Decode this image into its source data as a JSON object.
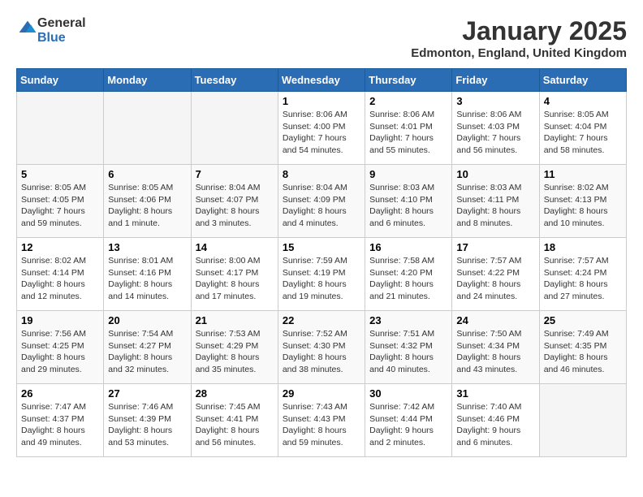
{
  "header": {
    "logo_general": "General",
    "logo_blue": "Blue",
    "title": "January 2025",
    "subtitle": "Edmonton, England, United Kingdom"
  },
  "days_of_week": [
    "Sunday",
    "Monday",
    "Tuesday",
    "Wednesday",
    "Thursday",
    "Friday",
    "Saturday"
  ],
  "weeks": [
    [
      {
        "day": "",
        "info": ""
      },
      {
        "day": "",
        "info": ""
      },
      {
        "day": "",
        "info": ""
      },
      {
        "day": "1",
        "info": "Sunrise: 8:06 AM\nSunset: 4:00 PM\nDaylight: 7 hours\nand 54 minutes."
      },
      {
        "day": "2",
        "info": "Sunrise: 8:06 AM\nSunset: 4:01 PM\nDaylight: 7 hours\nand 55 minutes."
      },
      {
        "day": "3",
        "info": "Sunrise: 8:06 AM\nSunset: 4:03 PM\nDaylight: 7 hours\nand 56 minutes."
      },
      {
        "day": "4",
        "info": "Sunrise: 8:05 AM\nSunset: 4:04 PM\nDaylight: 7 hours\nand 58 minutes."
      }
    ],
    [
      {
        "day": "5",
        "info": "Sunrise: 8:05 AM\nSunset: 4:05 PM\nDaylight: 7 hours\nand 59 minutes."
      },
      {
        "day": "6",
        "info": "Sunrise: 8:05 AM\nSunset: 4:06 PM\nDaylight: 8 hours\nand 1 minute."
      },
      {
        "day": "7",
        "info": "Sunrise: 8:04 AM\nSunset: 4:07 PM\nDaylight: 8 hours\nand 3 minutes."
      },
      {
        "day": "8",
        "info": "Sunrise: 8:04 AM\nSunset: 4:09 PM\nDaylight: 8 hours\nand 4 minutes."
      },
      {
        "day": "9",
        "info": "Sunrise: 8:03 AM\nSunset: 4:10 PM\nDaylight: 8 hours\nand 6 minutes."
      },
      {
        "day": "10",
        "info": "Sunrise: 8:03 AM\nSunset: 4:11 PM\nDaylight: 8 hours\nand 8 minutes."
      },
      {
        "day": "11",
        "info": "Sunrise: 8:02 AM\nSunset: 4:13 PM\nDaylight: 8 hours\nand 10 minutes."
      }
    ],
    [
      {
        "day": "12",
        "info": "Sunrise: 8:02 AM\nSunset: 4:14 PM\nDaylight: 8 hours\nand 12 minutes."
      },
      {
        "day": "13",
        "info": "Sunrise: 8:01 AM\nSunset: 4:16 PM\nDaylight: 8 hours\nand 14 minutes."
      },
      {
        "day": "14",
        "info": "Sunrise: 8:00 AM\nSunset: 4:17 PM\nDaylight: 8 hours\nand 17 minutes."
      },
      {
        "day": "15",
        "info": "Sunrise: 7:59 AM\nSunset: 4:19 PM\nDaylight: 8 hours\nand 19 minutes."
      },
      {
        "day": "16",
        "info": "Sunrise: 7:58 AM\nSunset: 4:20 PM\nDaylight: 8 hours\nand 21 minutes."
      },
      {
        "day": "17",
        "info": "Sunrise: 7:57 AM\nSunset: 4:22 PM\nDaylight: 8 hours\nand 24 minutes."
      },
      {
        "day": "18",
        "info": "Sunrise: 7:57 AM\nSunset: 4:24 PM\nDaylight: 8 hours\nand 27 minutes."
      }
    ],
    [
      {
        "day": "19",
        "info": "Sunrise: 7:56 AM\nSunset: 4:25 PM\nDaylight: 8 hours\nand 29 minutes."
      },
      {
        "day": "20",
        "info": "Sunrise: 7:54 AM\nSunset: 4:27 PM\nDaylight: 8 hours\nand 32 minutes."
      },
      {
        "day": "21",
        "info": "Sunrise: 7:53 AM\nSunset: 4:29 PM\nDaylight: 8 hours\nand 35 minutes."
      },
      {
        "day": "22",
        "info": "Sunrise: 7:52 AM\nSunset: 4:30 PM\nDaylight: 8 hours\nand 38 minutes."
      },
      {
        "day": "23",
        "info": "Sunrise: 7:51 AM\nSunset: 4:32 PM\nDaylight: 8 hours\nand 40 minutes."
      },
      {
        "day": "24",
        "info": "Sunrise: 7:50 AM\nSunset: 4:34 PM\nDaylight: 8 hours\nand 43 minutes."
      },
      {
        "day": "25",
        "info": "Sunrise: 7:49 AM\nSunset: 4:35 PM\nDaylight: 8 hours\nand 46 minutes."
      }
    ],
    [
      {
        "day": "26",
        "info": "Sunrise: 7:47 AM\nSunset: 4:37 PM\nDaylight: 8 hours\nand 49 minutes."
      },
      {
        "day": "27",
        "info": "Sunrise: 7:46 AM\nSunset: 4:39 PM\nDaylight: 8 hours\nand 53 minutes."
      },
      {
        "day": "28",
        "info": "Sunrise: 7:45 AM\nSunset: 4:41 PM\nDaylight: 8 hours\nand 56 minutes."
      },
      {
        "day": "29",
        "info": "Sunrise: 7:43 AM\nSunset: 4:43 PM\nDaylight: 8 hours\nand 59 minutes."
      },
      {
        "day": "30",
        "info": "Sunrise: 7:42 AM\nSunset: 4:44 PM\nDaylight: 9 hours\nand 2 minutes."
      },
      {
        "day": "31",
        "info": "Sunrise: 7:40 AM\nSunset: 4:46 PM\nDaylight: 9 hours\nand 6 minutes."
      },
      {
        "day": "",
        "info": ""
      }
    ]
  ]
}
